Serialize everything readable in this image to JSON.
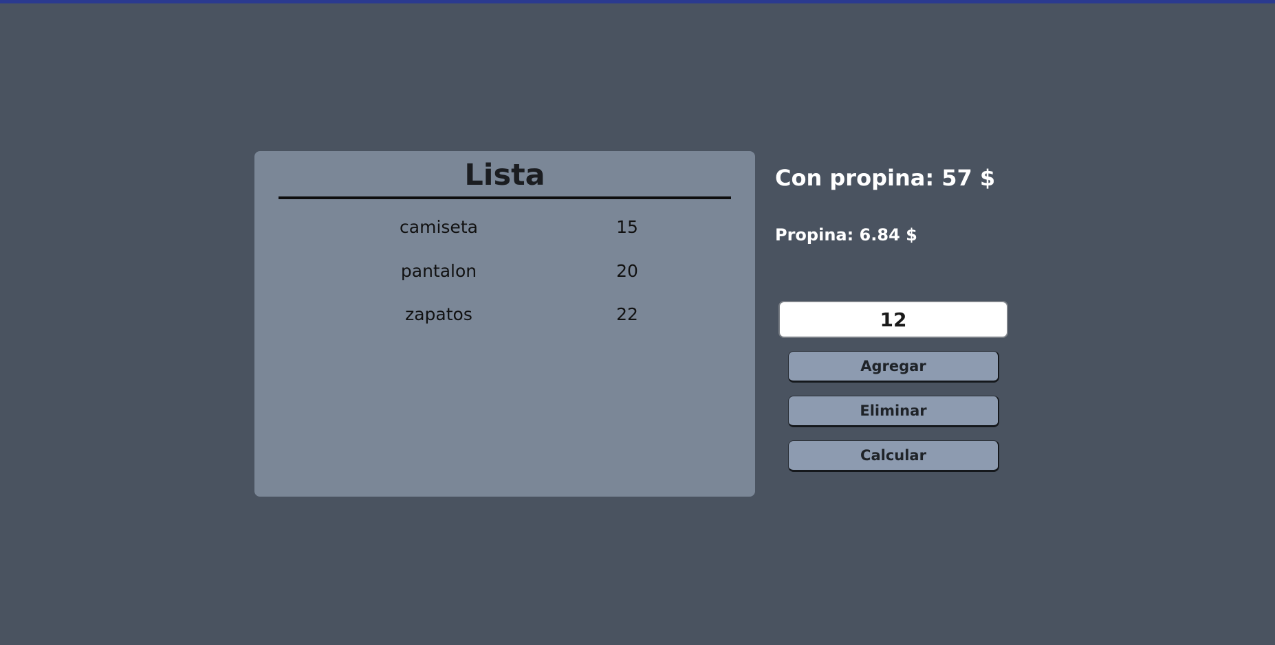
{
  "list": {
    "title": "Lista",
    "items": [
      {
        "name": "camiseta",
        "price": "15"
      },
      {
        "name": "pantalon",
        "price": "20"
      },
      {
        "name": "zapatos",
        "price": "22"
      }
    ]
  },
  "totals": {
    "with_tip": "Con propina: 57 $",
    "tip": "Propina: 6.84 $"
  },
  "form": {
    "value": "12"
  },
  "buttons": {
    "add_label": "Agregar",
    "remove_label": "Eliminar",
    "calculate_label": "Calcular"
  },
  "colors": {
    "background": "#4a5360",
    "panel": "#7b8797",
    "button": "#8d9bb0",
    "top_accent": "#2b3a8f"
  }
}
